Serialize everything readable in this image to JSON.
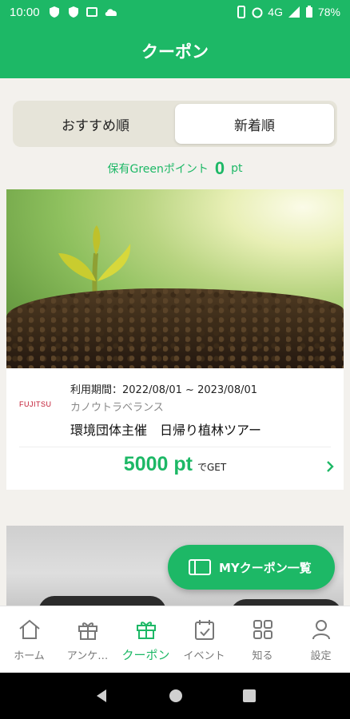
{
  "status_bar": {
    "time": "10:00",
    "network": "4G",
    "battery": "78%"
  },
  "header": {
    "title": "クーポン"
  },
  "sort_tabs": [
    {
      "label": "おすすめ順",
      "active": false
    },
    {
      "label": "新着順",
      "active": true
    }
  ],
  "points": {
    "label": "保有Greenポイント",
    "value": "0",
    "unit": "pt"
  },
  "coupons": [
    {
      "logo_text": "FUJITSU",
      "period": "利用期間：2022/08/01 ~ 2023/08/01",
      "merchant": "カノウトラベランス",
      "title": "環境団体主催　日帰り植林ツアー",
      "price": "5000 pt",
      "price_suffix": "でGET"
    }
  ],
  "fab": {
    "label": "MYクーポン一覧"
  },
  "bottom_nav": [
    {
      "label": "ホーム",
      "icon": "home-icon",
      "active": false
    },
    {
      "label": "アンケ…",
      "icon": "gift-icon",
      "active": false
    },
    {
      "label": "クーポン",
      "icon": "coupon-gift-icon",
      "active": true
    },
    {
      "label": "イベント",
      "icon": "calendar-icon",
      "active": false
    },
    {
      "label": "知る",
      "icon": "grid-icon",
      "active": false
    },
    {
      "label": "設定",
      "icon": "person-icon",
      "active": false
    }
  ],
  "colors": {
    "primary": "#1db866",
    "background": "#f3f1ed"
  }
}
